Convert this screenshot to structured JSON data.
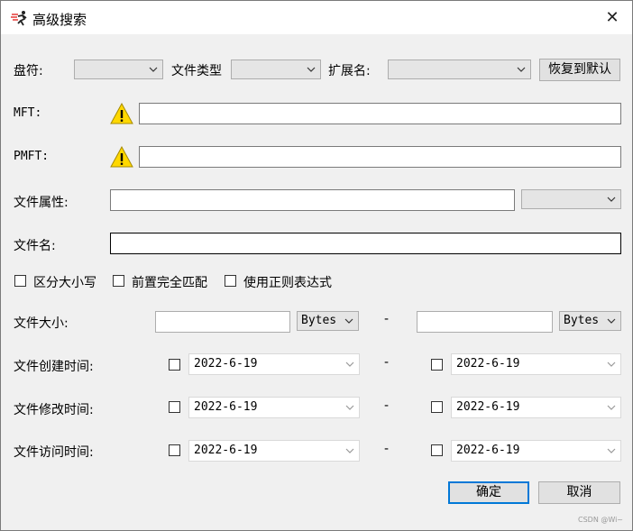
{
  "window": {
    "title": "高级搜索",
    "close_glyph": "✕"
  },
  "row1": {
    "drive_label": "盘符:",
    "drive_value": "",
    "filetype_label": "文件类型",
    "filetype_value": "",
    "ext_label": "扩展名:",
    "ext_value": "",
    "reset_button": "恢复到默认"
  },
  "mft": {
    "label": "MFT:",
    "value": "",
    "warning_icon": "warning-icon"
  },
  "pmft": {
    "label": "PMFT:",
    "value": "",
    "warning_icon": "warning-icon"
  },
  "attr": {
    "label": "文件属性:",
    "value": "",
    "select_value": ""
  },
  "filename": {
    "label": "文件名:",
    "value": ""
  },
  "options": {
    "case_sensitive": "区分大小写",
    "prefix_full_match": "前置完全匹配",
    "use_regex": "使用正则表达式"
  },
  "size": {
    "label": "文件大小:",
    "from_value": "",
    "from_unit": "Bytes",
    "separator": "-",
    "to_value": "",
    "to_unit": "Bytes"
  },
  "created": {
    "label": "文件创建时间:",
    "from": "2022-6-19",
    "separator": "-",
    "to": "2022-6-19"
  },
  "modified": {
    "label": "文件修改时间:",
    "from": "2022-6-19",
    "separator": "-",
    "to": "2022-6-19"
  },
  "accessed": {
    "label": "文件访问时间:",
    "from": "2022-6-19",
    "separator": "-",
    "to": "2022-6-19"
  },
  "footer": {
    "ok": "确定",
    "cancel": "取消",
    "watermark": "CSDN @Wi~"
  },
  "colors": {
    "accent": "#0078d7",
    "warning": "#ffd800",
    "background": "#f0f0f0"
  }
}
